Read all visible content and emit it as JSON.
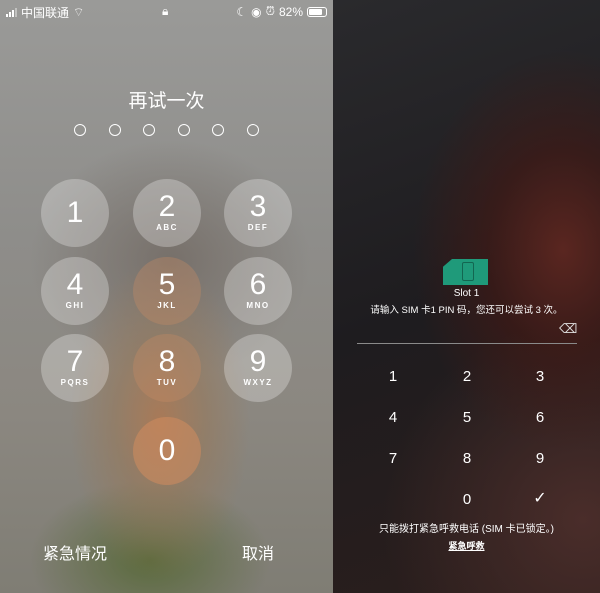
{
  "status_bar": {
    "carrier": "中国联通",
    "battery": "82%"
  },
  "passcode": {
    "title": "再试一次",
    "digits_entered": 0,
    "digits_total": 6
  },
  "keypad": [
    {
      "num": "1",
      "letters": ""
    },
    {
      "num": "2",
      "letters": "ABC"
    },
    {
      "num": "3",
      "letters": "DEF"
    },
    {
      "num": "4",
      "letters": "GHI"
    },
    {
      "num": "5",
      "letters": "JKL"
    },
    {
      "num": "6",
      "letters": "MNO"
    },
    {
      "num": "7",
      "letters": "PQRS"
    },
    {
      "num": "8",
      "letters": "TUV"
    },
    {
      "num": "9",
      "letters": "WXYZ"
    },
    {
      "num": "0",
      "letters": ""
    }
  ],
  "bottom": {
    "emergency": "紧急情况",
    "cancel": "取消"
  },
  "sim": {
    "slot": "Slot 1",
    "prompt": "请输入 SIM 卡1 PIN 码，您还可以尝试 3 次。",
    "color": "#1f9a7a",
    "keys": [
      "1",
      "2",
      "3",
      "4",
      "5",
      "6",
      "7",
      "8",
      "9",
      "0"
    ],
    "note": "只能拨打紧急呼救电话 (SIM 卡已锁定。)",
    "emergency": "紧急呼救"
  }
}
